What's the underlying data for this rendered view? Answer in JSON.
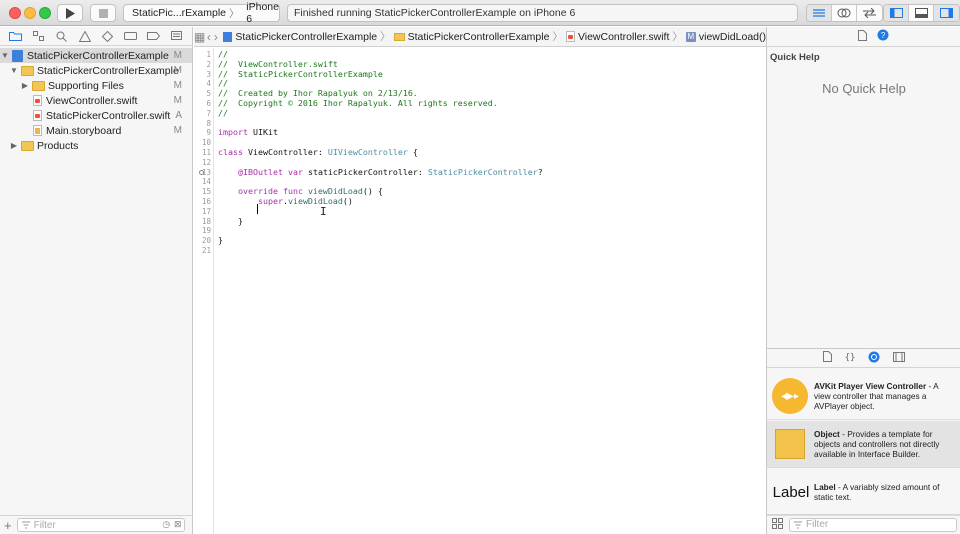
{
  "toolbar": {
    "scheme_name": "StaticPic...rExample",
    "device_name": "iPhone 6",
    "activity_text": "Finished running StaticPickerControllerExample on iPhone 6"
  },
  "navigator": {
    "items": [
      {
        "label": "StaticPickerControllerExample",
        "badge": "M"
      },
      {
        "label": "StaticPickerControllerExample",
        "badge": "M"
      },
      {
        "label": "Supporting Files",
        "badge": "M"
      },
      {
        "label": "ViewController.swift",
        "badge": "M"
      },
      {
        "label": "StaticPickerController.swift",
        "badge": "A"
      },
      {
        "label": "Main.storyboard",
        "badge": "M"
      },
      {
        "label": "Products",
        "badge": ""
      }
    ],
    "filter_placeholder": "Filter"
  },
  "jumpbar": {
    "crumbs": [
      "StaticPickerControllerExample",
      "StaticPickerControllerExample",
      "ViewController.swift",
      "viewDidLoad()"
    ]
  },
  "code_lines": [
    "//",
    "//  ViewController.swift",
    "//  StaticPickerControllerExample",
    "//",
    "//  Created by Ihor Rapalyuk on 2/13/16.",
    "//  Copyright © 2016 Ihor Rapalyuk. All rights reserved.",
    "//",
    "",
    "import UIKit",
    "",
    "class ViewController: UIViewController {",
    "",
    "    @IBOutlet var staticPickerController: StaticPickerController?",
    "",
    "    override func viewDidLoad() {",
    "        super.viewDidLoad()",
    "        ",
    "    }",
    "",
    "}",
    ""
  ],
  "utilities": {
    "quick_help_title": "Quick Help",
    "quick_help_empty": "No Quick Help",
    "library": [
      {
        "name": "AVKit Player View Controller",
        "desc": " - A view controller that manages a AVPlayer object."
      },
      {
        "name": "Object",
        "desc": " - Provides a template for objects and controllers not directly available in Interface Builder."
      },
      {
        "name": "Label",
        "desc": " - A variably sized amount of static text.",
        "icon_text": "Label"
      }
    ],
    "filter_placeholder": "Filter"
  }
}
